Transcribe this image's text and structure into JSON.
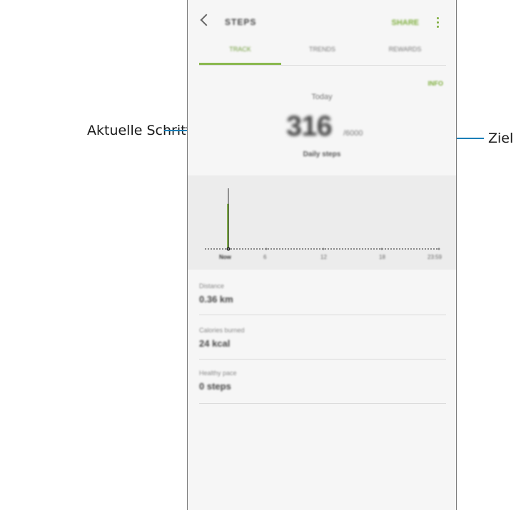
{
  "callouts": {
    "left": "Aktuelle Schrittzahl",
    "right": "Ziel",
    "line_color": "#1a7fb8"
  },
  "app": {
    "title": "STEPS",
    "share_label": "SHARE",
    "tabs": [
      "TRACK",
      "TRENDS",
      "REWARDS"
    ],
    "active_tab": 0,
    "info_label": "INFO",
    "today_label": "Today",
    "step_count": "316",
    "goal_text": "/6000",
    "daily_label": "Daily steps",
    "accent_color": "#8ab84f"
  },
  "chart_data": {
    "type": "bar",
    "categories": [
      "Now",
      "6",
      "12",
      "18",
      "23:59"
    ],
    "values": [
      316,
      0,
      0,
      0,
      0
    ],
    "current_marker": "Now"
  },
  "stats": [
    {
      "label": "Distance",
      "value": "0.36 km"
    },
    {
      "label": "Calories burned",
      "value": "24 kcal"
    },
    {
      "label": "Healthy pace",
      "value": "0 steps"
    }
  ]
}
